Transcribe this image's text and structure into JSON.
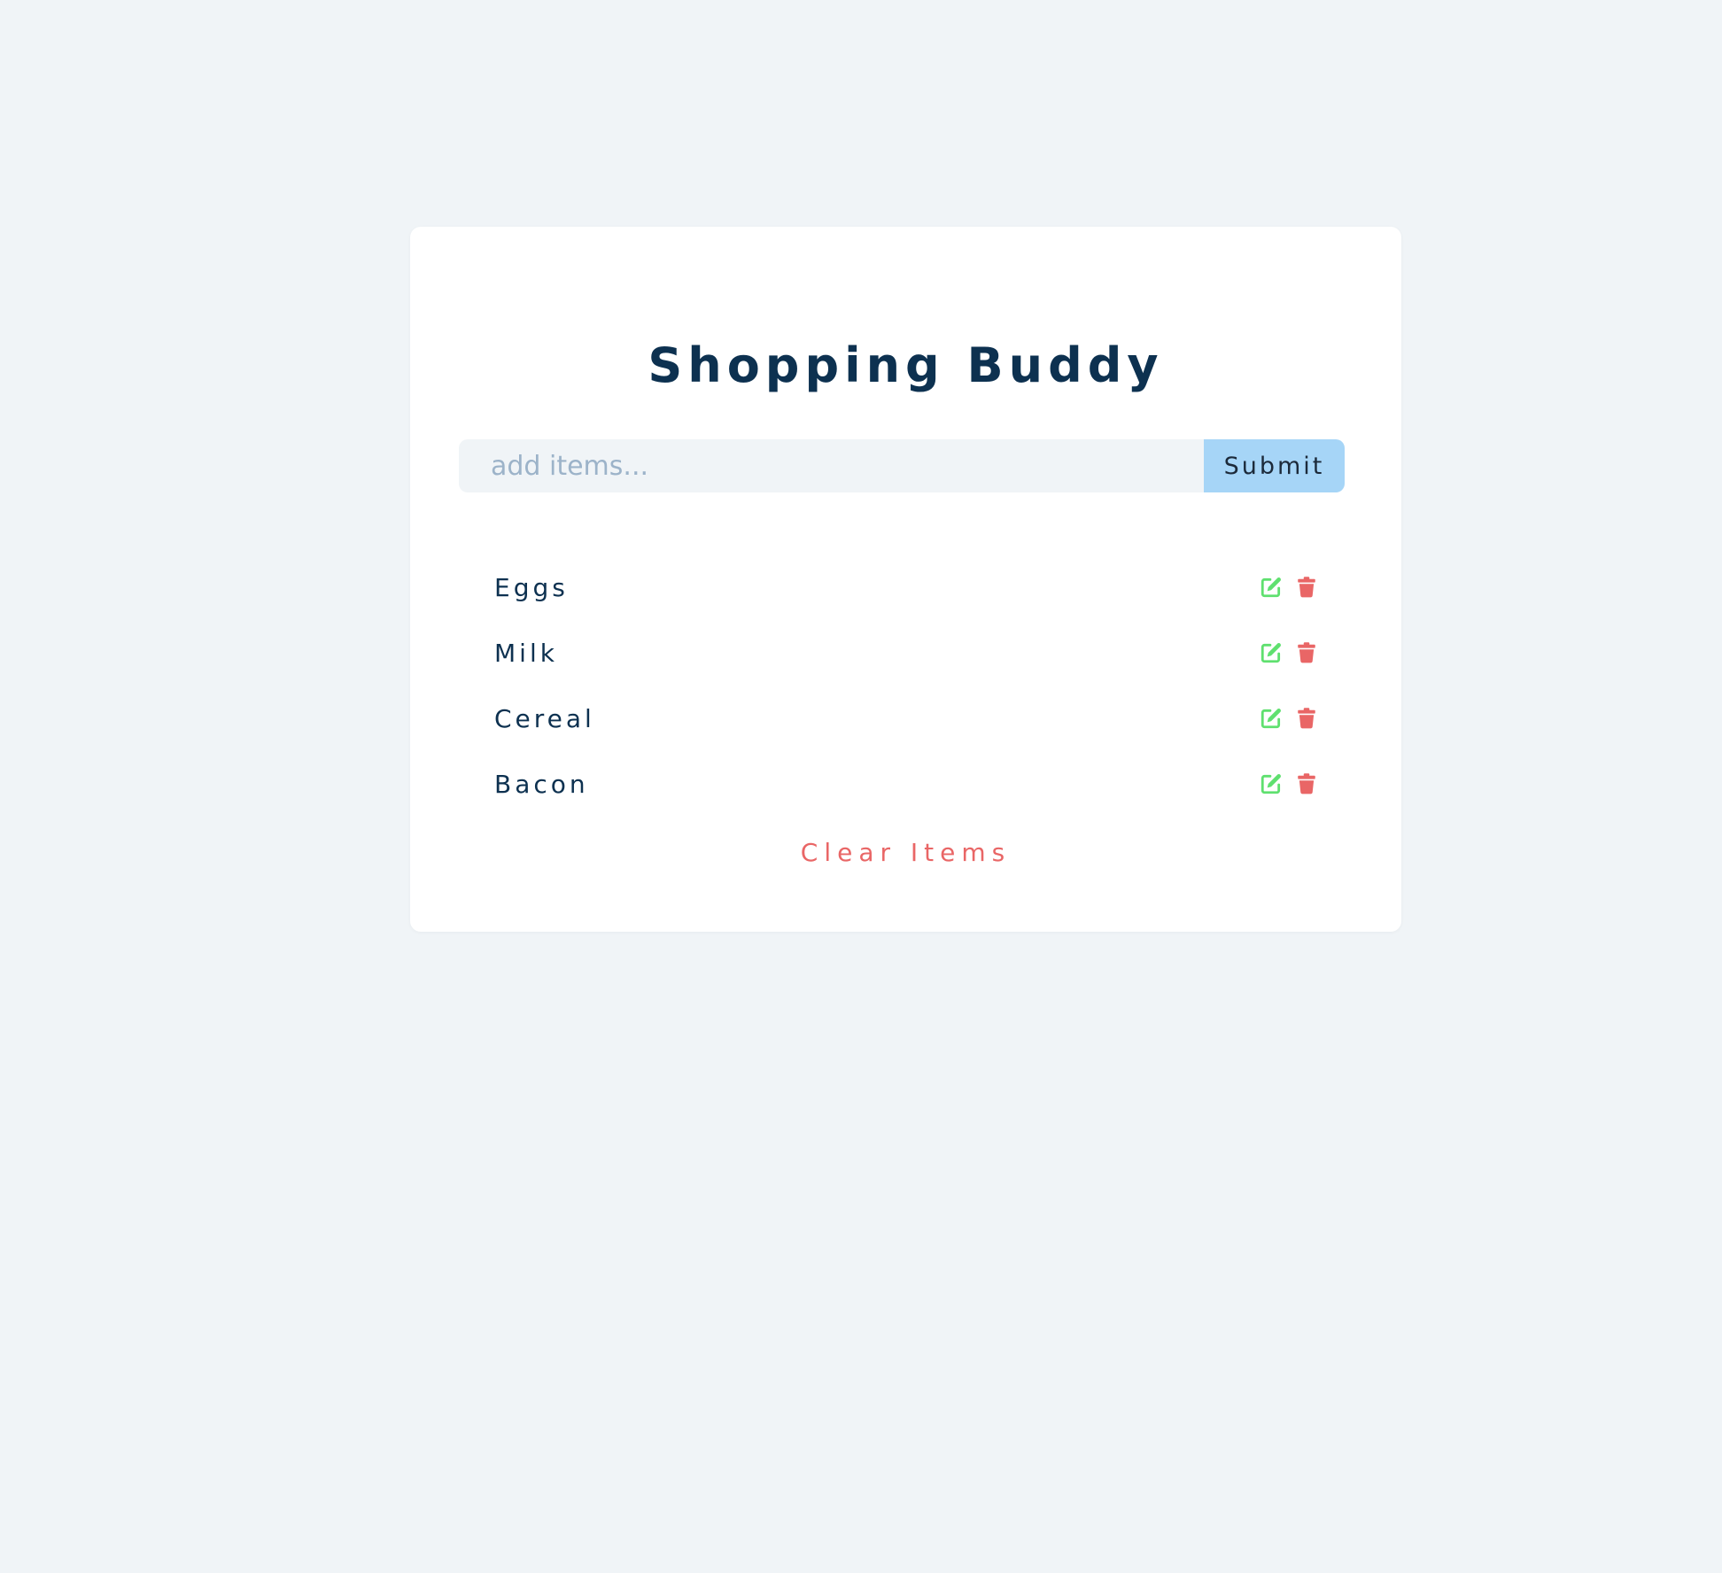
{
  "app": {
    "title": "Shopping Buddy"
  },
  "form": {
    "placeholder": "add items...",
    "value": "",
    "submit_label": "Submit"
  },
  "items": [
    {
      "name": "Eggs"
    },
    {
      "name": "Milk"
    },
    {
      "name": "Cereal"
    },
    {
      "name": "Bacon"
    }
  ],
  "actions": {
    "clear_label": "Clear Items"
  },
  "icons": {
    "edit": "edit-icon",
    "delete": "trash-icon"
  },
  "colors": {
    "background": "#f0f4f7",
    "card": "#ffffff",
    "title": "#0d3150",
    "submit": "#a6d5f7",
    "edit": "#5fe06f",
    "delete": "#e96666",
    "clear": "#e96666",
    "placeholder": "#9cb3c9"
  }
}
